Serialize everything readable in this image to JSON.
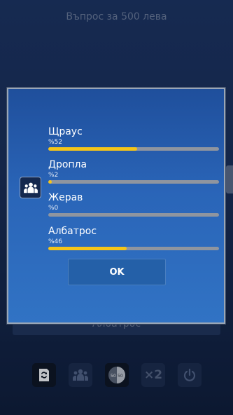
{
  "background": {
    "question_title": "Въпрос за 500 лева",
    "answer_option": "Албатрос"
  },
  "lifelines": [
    {
      "name": "change-question",
      "icon": "swap-icon",
      "state": "available"
    },
    {
      "name": "ask-audience",
      "icon": "audience-icon",
      "state": "used"
    },
    {
      "name": "fifty-fifty",
      "icon": "fifty-fifty-icon",
      "label_left": "50",
      "label_right": "50",
      "state": "available"
    },
    {
      "name": "double-answer",
      "icon": "x2-icon",
      "label": "×2",
      "state": "used"
    },
    {
      "name": "quit",
      "icon": "power-icon",
      "state": "used"
    }
  ],
  "dialog": {
    "icon": "audience-icon",
    "results": [
      {
        "label": "Щраус",
        "percent_text": "%52",
        "percent": 52
      },
      {
        "label": "Дропла",
        "percent_text": "%2",
        "percent": 2
      },
      {
        "label": "Жерав",
        "percent_text": "%0",
        "percent": 0
      },
      {
        "label": "Албатрос",
        "percent_text": "%46",
        "percent": 46
      }
    ],
    "ok_label": "OK"
  },
  "colors": {
    "bar_fill": "#f5c518",
    "bar_track": "#8f959f",
    "dialog_top": "#1f4f9c",
    "dialog_bottom": "#3173c4"
  }
}
